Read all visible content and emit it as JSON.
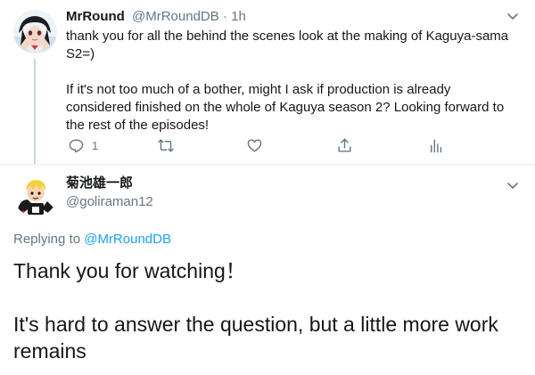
{
  "reply_tweet": {
    "author_name": "MrRound",
    "author_handle": "@MrRoundDB",
    "separator": "·",
    "time": "1h",
    "text_paragraphs": [
      "thank you for all the behind the scenes look at the making of Kaguya-sama S2=)",
      "If it's not too much of a bother, might I ask if production is already considered finished on the whole of Kaguya season 2? Looking forward to the rest of the episodes!"
    ],
    "actions": {
      "reply_icon": "reply-icon",
      "reply_count": "1",
      "retweet_icon": "retweet-icon",
      "like_icon": "heart-icon",
      "share_icon": "share-icon",
      "analytics_icon": "analytics-icon"
    }
  },
  "main_tweet": {
    "author_name": "菊池雄一郎",
    "author_handle": "@goliraman12",
    "replying_prefix": "Replying to",
    "replying_mention": "@MrRoundDB",
    "text_paragraphs": [
      "Thank you for watching！",
      "It's hard to answer the question, but a little more work remains"
    ]
  },
  "colors": {
    "text_primary": "#14171a",
    "text_secondary": "#657786",
    "link": "#1da1f2",
    "divider": "#e6ecf0"
  }
}
